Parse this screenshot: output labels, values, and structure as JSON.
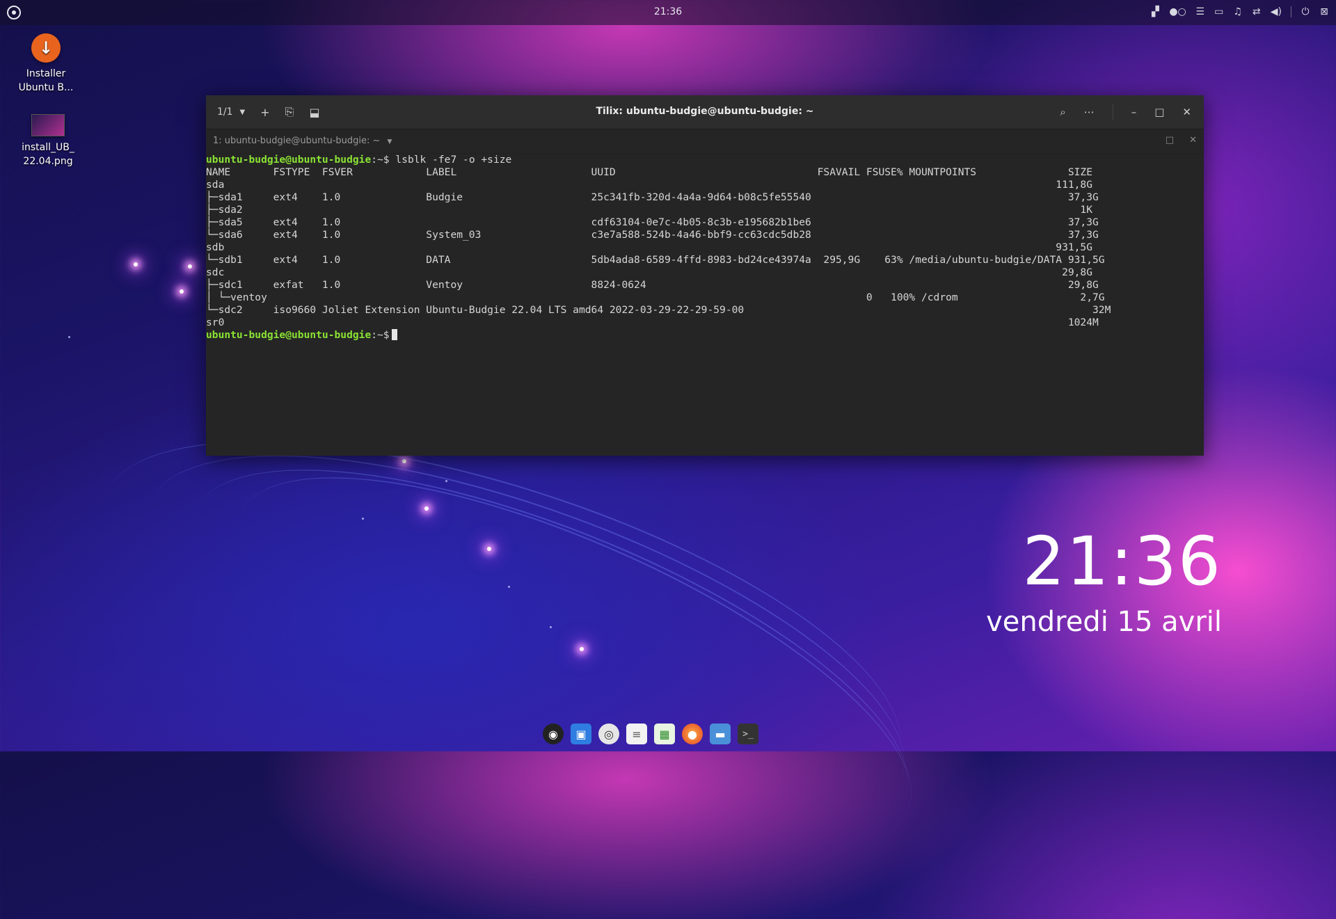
{
  "top_panel": {
    "clock": "21:36",
    "tray_icons": [
      "screenshot-icon",
      "toggle-icon",
      "list-icon",
      "files-icon",
      "bell-icon",
      "network-icon",
      "volume-icon",
      "power-icon",
      "exit-icon"
    ]
  },
  "desktop_icons": [
    {
      "label_line1": "Installer",
      "label_line2": "Ubuntu B..."
    },
    {
      "label_line1": "install_UB_",
      "label_line2": "22.04.png"
    }
  ],
  "terminal": {
    "session_counter": "1/1",
    "title": "Tilix: ubuntu-budgie@ubuntu-budgie: ~",
    "tab_label": "1: ubuntu-budgie@ubuntu-budgie: ~",
    "prompt_user": "ubuntu-budgie@ubuntu-budgie",
    "prompt_path": ":~$",
    "command": " lsblk -fe7 -o +size",
    "output_lines": [
      "NAME       FSTYPE  FSVER            LABEL                      UUID                                 FSAVAIL FSUSE% MOUNTPOINTS               SIZE",
      "sda                                                                                                                                        111,8G",
      "├─sda1     ext4    1.0              Budgie                     25c341fb-320d-4a4a-9d64-b08c5fe55540                                          37,3G",
      "├─sda2                                                                                                                                         1K",
      "├─sda5     ext4    1.0                                         cdf63104-0e7c-4b05-8c3b-e195682b1be6                                          37,3G",
      "└─sda6     ext4    1.0              System_03                  c3e7a588-524b-4a46-bbf9-cc63cdc5db28                                          37,3G",
      "sdb                                                                                                                                        931,5G",
      "└─sdb1     ext4    1.0              DATA                       5db4ada8-6589-4ffd-8983-bd24ce43974a  295,9G    63% /media/ubuntu-budgie/DATA 931,5G",
      "sdc                                                                                                                                         29,8G",
      "├─sdc1     exfat   1.0              Ventoy                     8824-0624                                                                     29,8G",
      "│ └─ventoy                                                                                                  0   100% /cdrom                    2,7G",
      "└─sdc2     iso9660 Joliet Extension Ubuntu-Budgie 22.04 LTS amd64 2022-03-29-22-29-59-00                                                         32M",
      "sr0                                                                                                                                          1024M"
    ]
  },
  "lock_clock": {
    "time": "21:36",
    "date": "vendredi 15 avril"
  },
  "dock_apps": [
    "budgie-menu-icon",
    "software-store-icon",
    "rhythmbox-icon",
    "text-editor-icon",
    "spreadsheet-icon",
    "firefox-icon",
    "files-icon",
    "terminal-icon"
  ],
  "colors": {
    "prompt": "#8ae234",
    "terminal_bg": "#252525",
    "installer_orange": "#e8641e"
  }
}
